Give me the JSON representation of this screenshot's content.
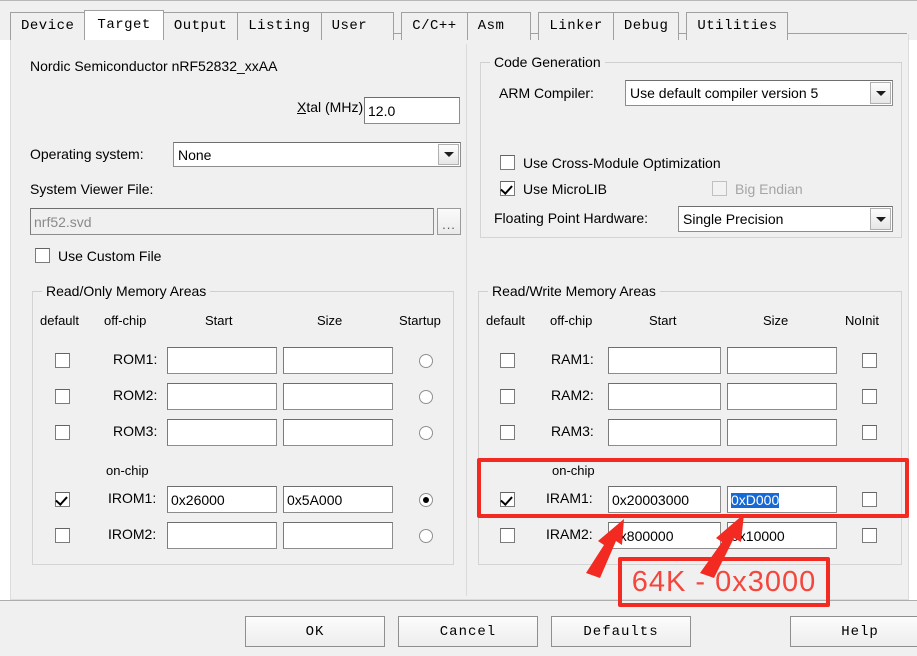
{
  "dialog": {
    "tabs": [
      {
        "label": "Device",
        "selected": false
      },
      {
        "label": "Target",
        "selected": true
      },
      {
        "label": "Output",
        "selected": false
      },
      {
        "label": "Listing",
        "selected": false
      },
      {
        "label": "User",
        "selected": false
      },
      {
        "label": "C/C++",
        "selected": false
      },
      {
        "label": "Asm",
        "selected": false
      },
      {
        "label": "Linker",
        "selected": false
      },
      {
        "label": "Debug",
        "selected": false
      },
      {
        "label": "Utilities",
        "selected": false
      }
    ]
  },
  "target": {
    "device_name": "Nordic Semiconductor nRF52832_xxAA",
    "xtal_label": "Xtal (MHz):",
    "xtal_value": "12.0",
    "os_label": "Operating system:",
    "os_value": "None",
    "svf_label": "System Viewer File:",
    "svf_value": "nrf52.svd",
    "browse_label": "...",
    "use_custom_file_label": "Use Custom File",
    "use_custom_file_checked": false
  },
  "code_generation": {
    "title": "Code Generation",
    "arm_compiler_label": "ARM Compiler:",
    "arm_compiler_value": "Use default compiler version 5",
    "cross_module_label": "Use Cross-Module Optimization",
    "cross_module_checked": false,
    "microlib_label": "Use MicroLIB",
    "microlib_checked": true,
    "big_endian_label": "Big Endian",
    "big_endian_checked": false,
    "big_endian_disabled": true,
    "fpu_label": "Floating Point Hardware:",
    "fpu_value": "Single Precision"
  },
  "readonly_memory": {
    "title": "Read/Only Memory Areas",
    "headers": {
      "default": "default",
      "offchip": "off-chip",
      "start": "Start",
      "size": "Size",
      "last": "Startup"
    },
    "onchip_label": "on-chip",
    "rows": [
      {
        "name": "ROM1:",
        "default": false,
        "start": "",
        "size": "",
        "startup": false
      },
      {
        "name": "ROM2:",
        "default": false,
        "start": "",
        "size": "",
        "startup": false
      },
      {
        "name": "ROM3:",
        "default": false,
        "start": "",
        "size": "",
        "startup": false
      },
      {
        "name": "IROM1:",
        "default": true,
        "start": "0x26000",
        "size": "0x5A000",
        "startup": true
      },
      {
        "name": "IROM2:",
        "default": false,
        "start": "",
        "size": "",
        "startup": false
      }
    ]
  },
  "readwrite_memory": {
    "title": "Read/Write Memory Areas",
    "headers": {
      "default": "default",
      "offchip": "off-chip",
      "start": "Start",
      "size": "Size",
      "last": "NoInit"
    },
    "onchip_label": "on-chip",
    "rows": [
      {
        "name": "RAM1:",
        "default": false,
        "start": "",
        "size": "",
        "noinit": false
      },
      {
        "name": "RAM2:",
        "default": false,
        "start": "",
        "size": "",
        "noinit": false
      },
      {
        "name": "RAM3:",
        "default": false,
        "start": "",
        "size": "",
        "noinit": false
      },
      {
        "name": "IRAM1:",
        "default": true,
        "start": "0x20003000",
        "size": "0xD000",
        "size_selected": true,
        "noinit": false
      },
      {
        "name": "IRAM2:",
        "default": false,
        "start": "0x800000",
        "size": "0x10000",
        "noinit": false
      }
    ]
  },
  "footer": {
    "ok": "OK",
    "cancel": "Cancel",
    "defaults": "Defaults",
    "help": "Help"
  },
  "annotation": {
    "note": "64K - 0x3000",
    "color": "#f32a21"
  }
}
